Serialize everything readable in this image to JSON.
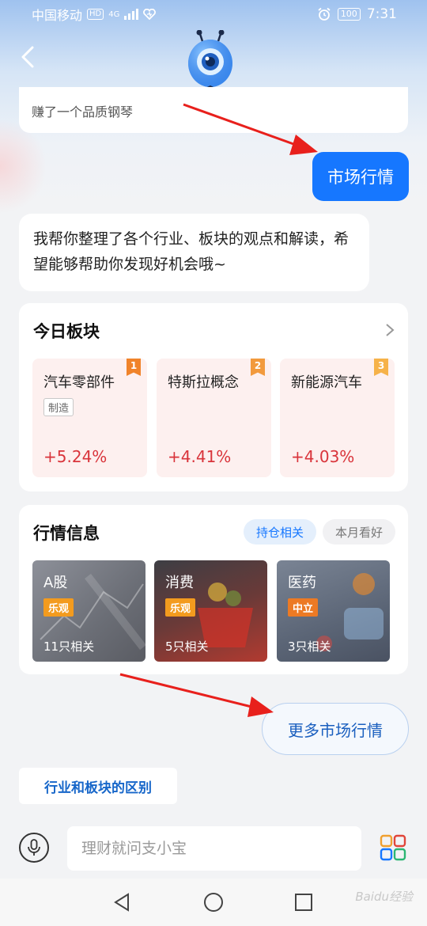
{
  "status_bar": {
    "carrier": "中国移动",
    "hd": "HD",
    "network": "4G",
    "battery": "100",
    "time": "7:31"
  },
  "chat": {
    "prev_message_tail": "赚了一个品质钢琴",
    "user_message": "市场行情",
    "bot_message": "我帮你整理了各个行业、板块的观点和解读，希望能够帮助你发现好机会哦~"
  },
  "today_sectors": {
    "title": "今日板块",
    "items": [
      {
        "name": "汽车零部件",
        "tag": "制造",
        "change": "+5.24%",
        "rank": "1"
      },
      {
        "name": "特斯拉概念",
        "tag": "",
        "change": "+4.41%",
        "rank": "2"
      },
      {
        "name": "新能源汽车",
        "tag": "",
        "change": "+4.03%",
        "rank": "3"
      }
    ]
  },
  "market_info": {
    "title": "行情信息",
    "tabs": [
      {
        "label": "持仓相关",
        "active": true
      },
      {
        "label": "本月看好",
        "active": false
      }
    ],
    "items": [
      {
        "name": "A股",
        "sentiment": "乐观",
        "count": "11只相关"
      },
      {
        "name": "消费",
        "sentiment": "乐观",
        "count": "5只相关"
      },
      {
        "name": "医药",
        "sentiment": "中立",
        "count": "3只相关"
      }
    ]
  },
  "actions": {
    "more_button": "更多市场行情",
    "suggestion_chip": "行业和板块的区别"
  },
  "input": {
    "placeholder": "理财就问支小宝"
  },
  "watermark": "Baidu经验",
  "colors": {
    "accent": "#1677ff",
    "rise": "#d9343b",
    "sentiment_tag": "#f39b1e"
  }
}
